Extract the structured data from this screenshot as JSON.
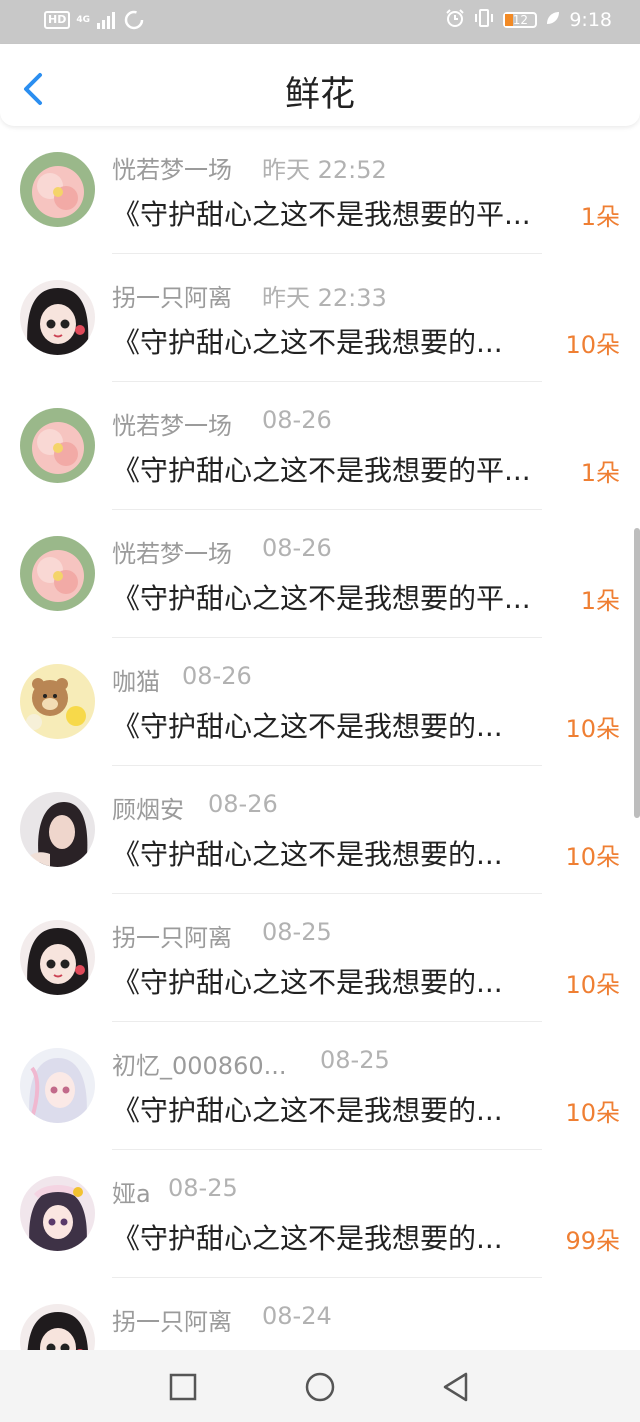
{
  "status_bar": {
    "hd": "HD",
    "network": "4G",
    "battery": "12",
    "time": "9:18"
  },
  "header": {
    "title": "鲜花"
  },
  "items": [
    {
      "name": "恍若梦一场",
      "time": "昨天 22:52",
      "desc": "《守护甜心之这不是我想要的平...",
      "amount": "1朵"
    },
    {
      "name": "拐一只阿离",
      "time": "昨天 22:33",
      "desc": "《守护甜心之这不是我想要的...",
      "amount": "10朵"
    },
    {
      "name": "恍若梦一场",
      "time": "08-26",
      "desc": "《守护甜心之这不是我想要的平...",
      "amount": "1朵"
    },
    {
      "name": "恍若梦一场",
      "time": "08-26",
      "desc": "《守护甜心之这不是我想要的平...",
      "amount": "1朵"
    },
    {
      "name": "咖猫",
      "time": "08-26",
      "desc": "《守护甜心之这不是我想要的...",
      "amount": "10朵"
    },
    {
      "name": "顾烟安",
      "time": "08-26",
      "desc": "《守护甜心之这不是我想要的...",
      "amount": "10朵"
    },
    {
      "name": "拐一只阿离",
      "time": "08-25",
      "desc": "《守护甜心之这不是我想要的...",
      "amount": "10朵"
    },
    {
      "name": "初忆_000860...",
      "time": "08-25",
      "desc": "《守护甜心之这不是我想要的...",
      "amount": "10朵"
    },
    {
      "name": "娅a",
      "time": "08-25",
      "desc": "《守护甜心之这不是我想要的...",
      "amount": "99朵"
    },
    {
      "name": "拐一只阿离",
      "time": "08-24",
      "desc": "",
      "amount": ""
    }
  ],
  "icons": {
    "back": "back-arrow-icon",
    "nav": [
      "recent-apps-icon",
      "home-icon",
      "back-triangle-icon"
    ]
  },
  "colors": {
    "accent_blue": "#2b8ef0",
    "amount_orange": "#ef7f33"
  }
}
